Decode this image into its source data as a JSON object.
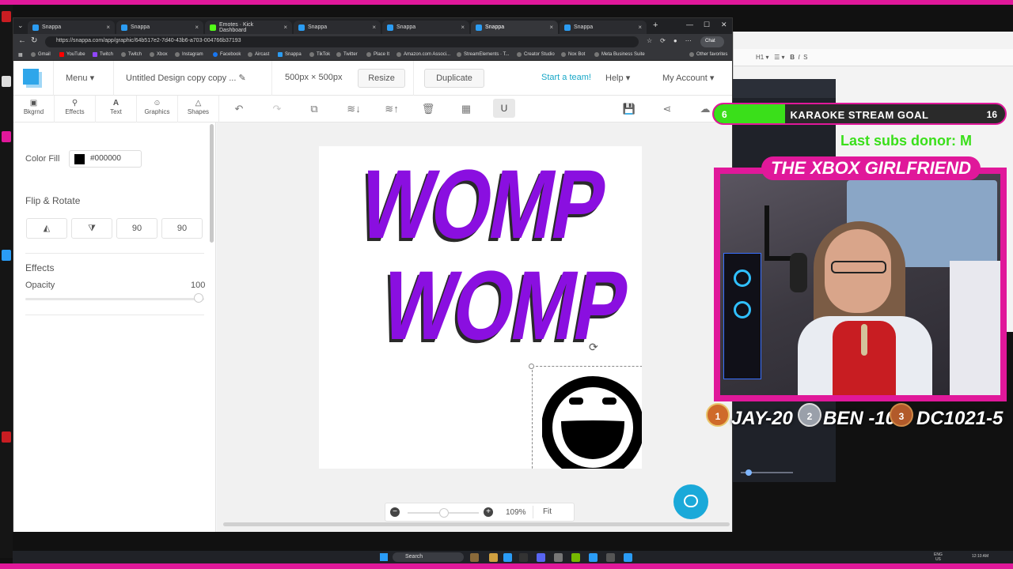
{
  "colors": {
    "stream_frame": "#e0189a",
    "womp_text": "#8a0fe0",
    "goal_fill": "#3adf1a",
    "snappa_blue": "#2fa6ea",
    "accent_teal": "#17a7c7"
  },
  "browser": {
    "tabs": [
      {
        "label": "Snappa",
        "close": "×"
      },
      {
        "label": "Snappa",
        "close": "×"
      },
      {
        "label": "Emotes · Kick Dashboard",
        "close": "×"
      },
      {
        "label": "Snappa",
        "close": "×"
      },
      {
        "label": "Snappa",
        "close": "×"
      },
      {
        "label": "Snappa",
        "close": "×"
      },
      {
        "label": "Snappa",
        "close": "×"
      }
    ],
    "new_tab": "+",
    "url": "https://snappa.com/app/graphic/64b517e2-7d40-43b6-a703-004766b37193",
    "chat_button": "Chat",
    "bookmarks": [
      "Gmail",
      "YouTube",
      "Twitch",
      "Twitch",
      "Xbox",
      "Instagram",
      "Facebook",
      "Aircast",
      "Snappa",
      "TikTok",
      "Twitter",
      "Place It",
      "Amazon.com Associ...",
      "StreamElements · T...",
      "Creator Studio",
      "Nox Bot",
      "Meta Business Suite"
    ],
    "other_favorites": "Other favorites"
  },
  "topnav": {
    "menu_label": "Menu",
    "design_title": "Untitled Design copy copy ...",
    "canvas_size": "500px × 500px",
    "resize_label": "Resize",
    "duplicate_label": "Duplicate",
    "start_team_label": "Start a team!",
    "help_label": "Help",
    "account_label": "My Account"
  },
  "tools": {
    "tabs": [
      {
        "label": "Bkgrnd",
        "icon": "image-icon"
      },
      {
        "label": "Effects",
        "icon": "wand-icon"
      },
      {
        "label": "Text",
        "icon": "text-icon"
      },
      {
        "label": "Graphics",
        "icon": "smiley-icon"
      },
      {
        "label": "Shapes",
        "icon": "triangle-icon"
      }
    ]
  },
  "panel": {
    "color_fill_label": "Color Fill",
    "color_fill_value": "#000000",
    "flip_rotate_title": "Flip & Rotate",
    "flip_buttons": [
      "flip-horizontal",
      "flip-vertical",
      "rotate-left-90",
      "rotate-right-90"
    ],
    "rotate_left_text": "90",
    "rotate_right_text": "90",
    "effects_title": "Effects",
    "opacity_label": "Opacity",
    "opacity_value": "100"
  },
  "canvas": {
    "line1": "WOMP",
    "line2": "WOMP",
    "zoom_value": "109%",
    "fit_label": "Fit"
  },
  "overlay": {
    "goal_left_number": "6",
    "goal_text": "KARAOKE STREAM GOAL",
    "goal_right_number": "16",
    "ticker_text": "Last subs donor: M",
    "banner_text": "THE XBOX GIRLFRIEND",
    "leaders": [
      {
        "rank": "1",
        "text": "JAY-20"
      },
      {
        "rank": "2",
        "text": "BEN -10"
      },
      {
        "rank": "3",
        "text": "DC1021-5"
      }
    ]
  },
  "taskbar": {
    "search_label": "Search",
    "tray_lang": "ENG",
    "tray_region": "US",
    "time": "12:10 AM"
  }
}
